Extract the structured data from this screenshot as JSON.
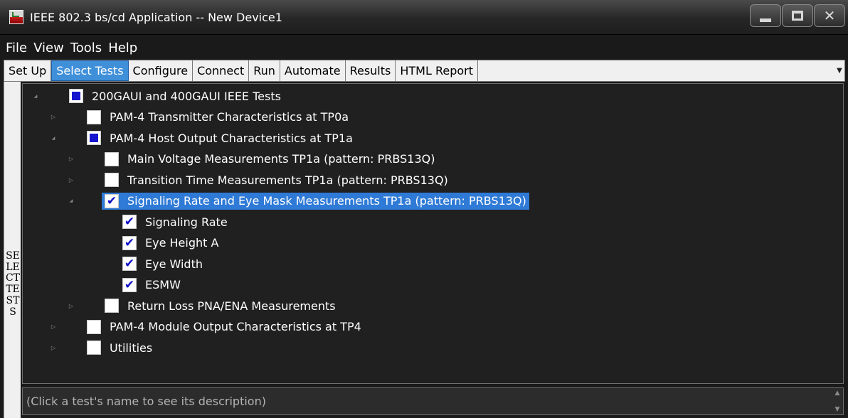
{
  "window": {
    "title": "IEEE 802.3 bs/cd Application -- New Device1"
  },
  "menu": [
    "File",
    "View",
    "Tools",
    "Help"
  ],
  "tabs": [
    {
      "label": "Set Up",
      "active": false
    },
    {
      "label": "Select Tests",
      "active": true
    },
    {
      "label": "Configure",
      "active": false
    },
    {
      "label": "Connect",
      "active": false
    },
    {
      "label": "Run",
      "active": false
    },
    {
      "label": "Automate",
      "active": false
    },
    {
      "label": "Results",
      "active": false
    },
    {
      "label": "HTML Report",
      "active": false
    }
  ],
  "side_label": "SELECT TESTS",
  "tree": [
    {
      "label": "200GAUI and 400GAUI IEEE Tests",
      "level": 0,
      "expander": "expanded",
      "state": "partial"
    },
    {
      "label": "PAM-4 Transmitter Characteristics at TP0a",
      "level": 1,
      "expander": "collapsed",
      "state": "unchecked"
    },
    {
      "label": "PAM-4 Host Output Characteristics at TP1a",
      "level": 1,
      "expander": "expanded",
      "state": "partial"
    },
    {
      "label": "Main Voltage Measurements TP1a (pattern: PRBS13Q)",
      "level": 2,
      "expander": "collapsed",
      "state": "unchecked"
    },
    {
      "label": "Transition Time Measurements TP1a (pattern: PRBS13Q)",
      "level": 2,
      "expander": "collapsed",
      "state": "unchecked"
    },
    {
      "label": "Signaling Rate and Eye Mask Measurements TP1a (pattern: PRBS13Q)",
      "level": 2,
      "expander": "expanded",
      "state": "checked",
      "selected": true
    },
    {
      "label": "Signaling Rate",
      "level": 3,
      "expander": "none",
      "state": "checked"
    },
    {
      "label": "Eye Height A",
      "level": 3,
      "expander": "none",
      "state": "checked"
    },
    {
      "label": "Eye Width",
      "level": 3,
      "expander": "none",
      "state": "checked"
    },
    {
      "label": "ESMW",
      "level": 3,
      "expander": "none",
      "state": "checked"
    },
    {
      "label": "Return Loss PNA/ENA Measurements",
      "level": 2,
      "expander": "collapsed",
      "state": "unchecked"
    },
    {
      "label": "PAM-4 Module Output Characteristics at TP4",
      "level": 1,
      "expander": "collapsed",
      "state": "unchecked"
    },
    {
      "label": "Utilities",
      "level": 1,
      "expander": "collapsed",
      "state": "unchecked"
    }
  ],
  "description": "(Click a test's name to see its description)",
  "colors": {
    "accent": "#3f8fd9",
    "selection": "#2f7ad6",
    "checkmark": "#1010c8",
    "background": "#202020"
  },
  "icons": {
    "app": "app-icon",
    "expanded": "expanded-triangle-icon",
    "collapsed": "collapsed-triangle-icon",
    "tab_overflow": "chevron-down-icon"
  }
}
